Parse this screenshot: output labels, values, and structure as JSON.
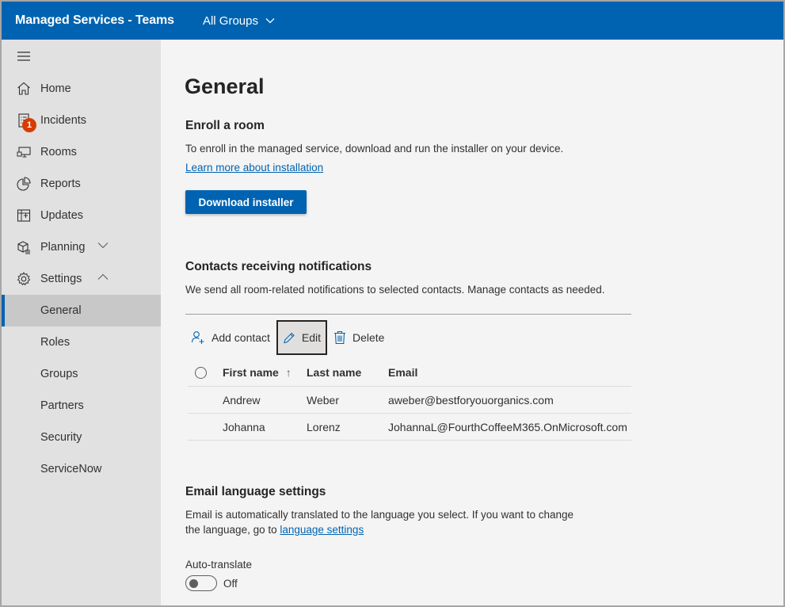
{
  "app": {
    "title": "Managed Services - Teams",
    "group_selector": "All Groups"
  },
  "sidebar": {
    "items": [
      {
        "label": "Home",
        "icon": "home-icon"
      },
      {
        "label": "Incidents",
        "icon": "incidents-icon",
        "badge": "1"
      },
      {
        "label": "Rooms",
        "icon": "rooms-icon"
      },
      {
        "label": "Reports",
        "icon": "reports-icon"
      },
      {
        "label": "Updates",
        "icon": "updates-icon"
      },
      {
        "label": "Planning",
        "icon": "planning-icon",
        "expand": "collapsed"
      },
      {
        "label": "Settings",
        "icon": "settings-icon",
        "expand": "expanded"
      }
    ],
    "sub_items": [
      {
        "label": "General",
        "selected": true
      },
      {
        "label": "Roles"
      },
      {
        "label": "Groups"
      },
      {
        "label": "Partners"
      },
      {
        "label": "Security"
      },
      {
        "label": "ServiceNow"
      }
    ]
  },
  "main": {
    "title": "General",
    "enroll": {
      "heading": "Enroll a room",
      "description": "To enroll in the managed service, download and run the installer on your device.",
      "link": "Learn more about installation",
      "button": "Download installer"
    },
    "contacts": {
      "heading": "Contacts receiving notifications",
      "description": "We send all room-related notifications to selected contacts. Manage contacts as needed.",
      "commands": {
        "add": "Add contact",
        "edit": "Edit",
        "delete": "Delete"
      },
      "columns": [
        "First name",
        "Last name",
        "Email"
      ],
      "sort_indicator": "↑",
      "rows": [
        {
          "first": "Andrew",
          "last": "Weber",
          "email": "aweber@bestforyouorganics.com"
        },
        {
          "first": "Johanna",
          "last": "Lorenz",
          "email": "JohannaL@FourthCoffeeM365.OnMicrosoft.com"
        }
      ]
    },
    "email_language": {
      "heading": "Email language settings",
      "description_line1": "Email is automatically translated to the language you select. If you want to change",
      "description_line2_prefix": "the language, go to ",
      "link": "language settings",
      "toggle_label": "Auto-translate",
      "toggle_state": "Off"
    }
  },
  "colors": {
    "brand": "#0063b1",
    "badge": "#d83b01",
    "sidebar_bg": "#e1e1e1",
    "main_bg": "#f4f4f4"
  }
}
